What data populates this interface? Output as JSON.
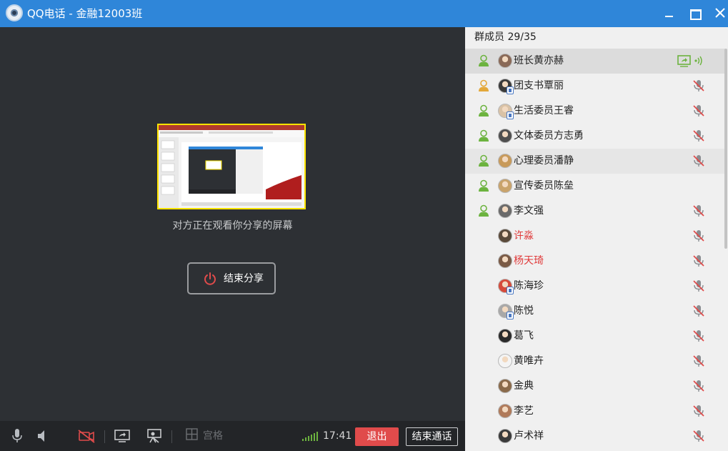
{
  "window": {
    "title": "QQ电话 - 金融12003班"
  },
  "main": {
    "status_text": "对方正在观看你分享的屏幕",
    "end_share_label": "结束分享"
  },
  "toolbar": {
    "grid_label": "宫格",
    "time": "17:41",
    "exit_label": "退出",
    "end_call_label": "结束通话"
  },
  "panel": {
    "header": "群成员 29/35",
    "members": [
      {
        "name": "班长黄亦赫",
        "online": true,
        "status": "sharing",
        "name_color": "normal",
        "avatar_color": "#8a6a58"
      },
      {
        "name": "团支书覃丽",
        "online": true,
        "status": "muted",
        "name_color": "normal",
        "avatar_color": "#3a3a3a"
      },
      {
        "name": "生活委员王睿",
        "online": true,
        "status": "muted",
        "name_color": "normal",
        "avatar_color": "#d9c2a6"
      },
      {
        "name": "文体委员方志勇",
        "online": true,
        "status": "muted",
        "name_color": "normal",
        "avatar_color": "#4f4f4f"
      },
      {
        "name": "心理委员潘静",
        "online": true,
        "status": "muted",
        "name_color": "normal",
        "avatar_color": "#c89a5a"
      },
      {
        "name": "宣传委员陈垒",
        "online": true,
        "status": "none",
        "name_color": "normal",
        "avatar_color": "#c9a36b"
      },
      {
        "name": "李文强",
        "online": true,
        "status": "muted",
        "name_color": "normal",
        "avatar_color": "#6a6a6a"
      },
      {
        "name": "许淼",
        "online": false,
        "status": "muted",
        "name_color": "red",
        "avatar_color": "#5a4a3a"
      },
      {
        "name": "杨天琦",
        "online": false,
        "status": "muted",
        "name_color": "red",
        "avatar_color": "#7a5a45"
      },
      {
        "name": "陈海珍",
        "online": false,
        "status": "muted",
        "name_color": "normal",
        "avatar_color": "#d64a3a"
      },
      {
        "name": "陈悦",
        "online": false,
        "status": "muted",
        "name_color": "normal",
        "avatar_color": "#a8a8a8"
      },
      {
        "name": "葛飞",
        "online": false,
        "status": "muted",
        "name_color": "normal",
        "avatar_color": "#2a2a2a"
      },
      {
        "name": "黄唯卉",
        "online": false,
        "status": "muted",
        "name_color": "normal",
        "avatar_color": "#f4f4f4"
      },
      {
        "name": "金典",
        "online": false,
        "status": "muted",
        "name_color": "normal",
        "avatar_color": "#8a6a4a"
      },
      {
        "name": "李艺",
        "online": false,
        "status": "muted",
        "name_color": "normal",
        "avatar_color": "#b07a5a"
      },
      {
        "name": "卢术祥",
        "online": false,
        "status": "muted",
        "name_color": "normal",
        "avatar_color": "#3a3a3a"
      }
    ]
  },
  "colors": {
    "titlebar": "#2f86d9",
    "exit_button": "#e04b4b",
    "share_border": "#ffe400",
    "online_green": "#6cb33f",
    "muted_red": "#e04b4b"
  }
}
